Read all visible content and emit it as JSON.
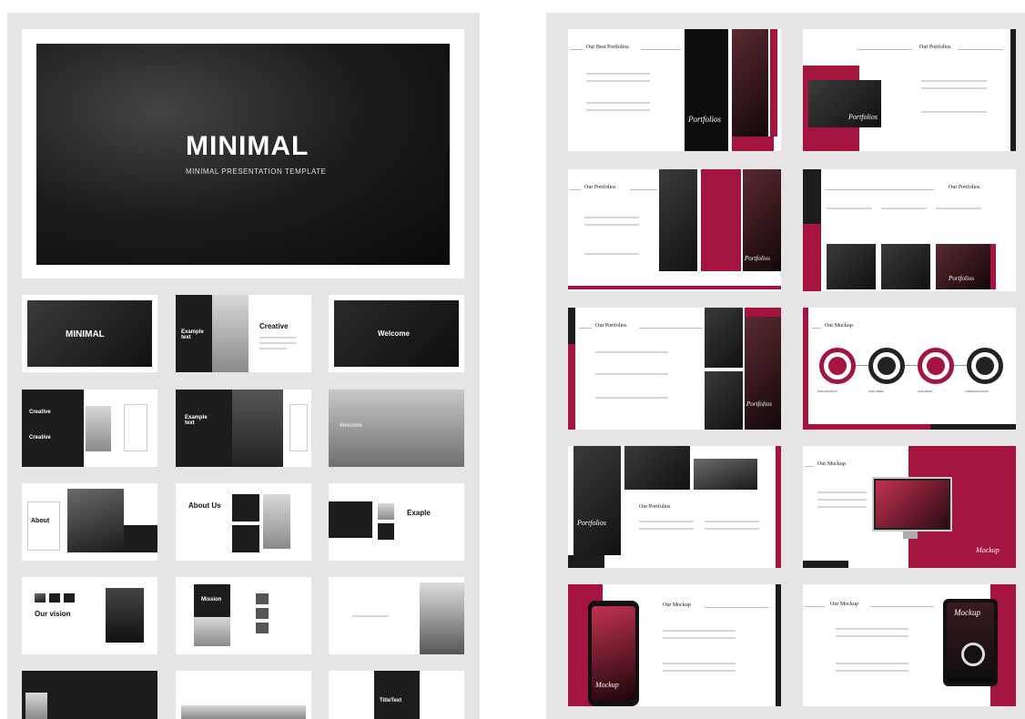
{
  "left": {
    "hero": {
      "title": "MINIMAL",
      "subtitle": "MINIMAL PRESENTATION TEMPLATE"
    },
    "thumbs": {
      "minimal_title": "MINIMAL",
      "creative": "Creative",
      "example_text": "Example text",
      "welcome": "Welcome",
      "creative_a": "Creative",
      "creative_b": "Creative",
      "example_text_2": "Example text",
      "welcome_2": "Welcome",
      "about": "About",
      "about_us": "About Us",
      "exaple": "Exaple",
      "our_vision": "Our vision",
      "mission": "Mission",
      "title_text": "TitleText"
    }
  },
  "right": {
    "our_best_portfolios": "Our Best Portfolios",
    "our_portfolios": "Our Portfolios",
    "our_mockup": "Our Mockup",
    "portfolios_script": "Portfolios",
    "mockup_script": "Mockup",
    "icon_captions": [
      "OUR PRODUCT",
      "OUR ITEMS",
      "OUR IDEAS",
      "COMMUNICATION"
    ]
  },
  "colors": {
    "accent": "#a3153f",
    "dark": "#1c1c1c",
    "panel": "#e6e4e5"
  }
}
